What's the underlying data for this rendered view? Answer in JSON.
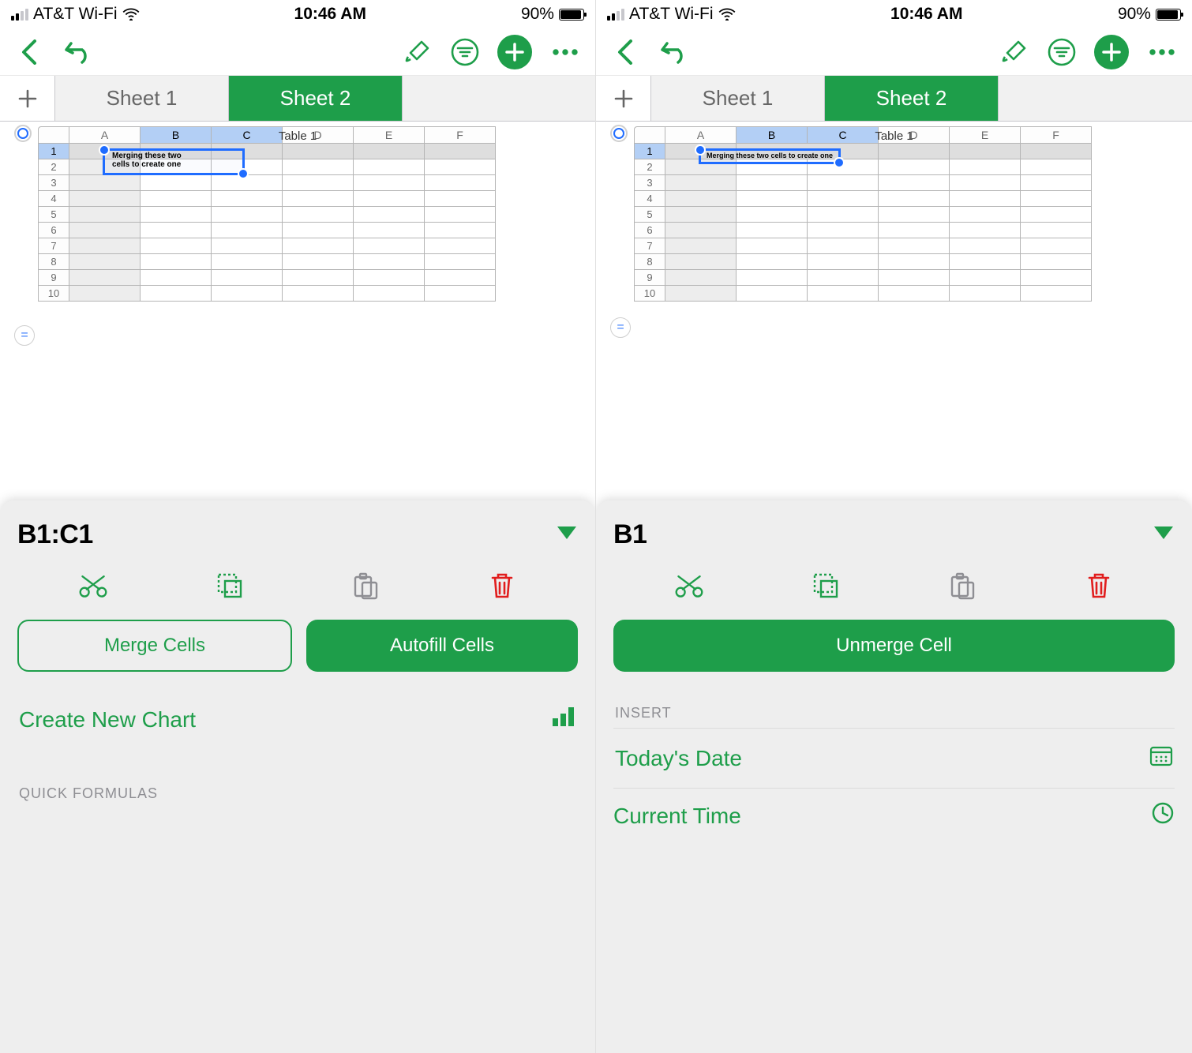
{
  "status": {
    "carrier": "AT&T Wi-Fi",
    "time": "10:46 AM",
    "battery_pct": "90%"
  },
  "tabs": {
    "sheet1": "Sheet 1",
    "sheet2": "Sheet 2"
  },
  "table": {
    "title": "Table 1",
    "columns": [
      "A",
      "B",
      "C",
      "D",
      "E",
      "F"
    ],
    "rows": [
      "1",
      "2",
      "3",
      "4",
      "5",
      "6",
      "7",
      "8",
      "9",
      "10"
    ]
  },
  "left": {
    "cell_ref": "B1:C1",
    "cell_text": "Merging these two cells to create one",
    "merge": "Merge Cells",
    "autofill": "Autofill Cells",
    "chart": "Create New Chart",
    "quick_formulas": "QUICK FORMULAS"
  },
  "right": {
    "cell_ref": "B1",
    "cell_text": "Merging these two cells to create one",
    "unmerge": "Unmerge Cell",
    "insert_label": "INSERT",
    "todays_date": "Today's Date",
    "current_time": "Current Time"
  },
  "formula_sym": "="
}
